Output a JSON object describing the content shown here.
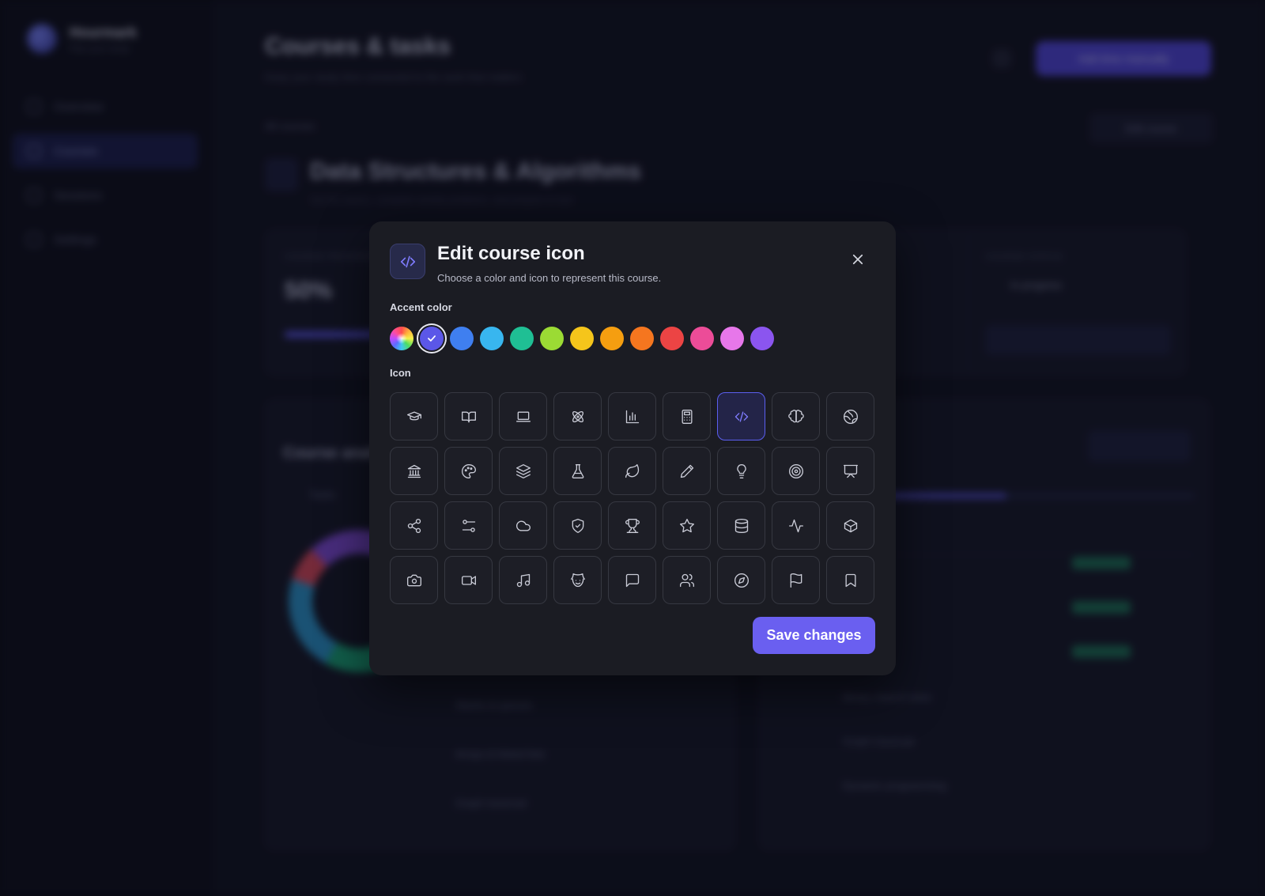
{
  "background": {
    "brand": {
      "name": "Hourmark",
      "sub": "Plan your study"
    },
    "nav": [
      {
        "label": "Overview"
      },
      {
        "label": "Courses"
      },
      {
        "label": "Sessions"
      },
      {
        "label": "Settings"
      }
    ],
    "page_title": "Courses & tasks",
    "page_sub": "Keep your study time connected to the work that matters",
    "top_button": "Add time manually",
    "back_link": "All courses",
    "edit_course": "Edit course",
    "course_title": "Data Structures & Algorithms",
    "course_sub": "Get the basics, complete weekly problems, and prepare to test",
    "progress_label": "COURSE PROGRESS",
    "progress_value": "50%",
    "status_label": "COURSE STATUS",
    "status_value": "In progress",
    "course_analytics": "Course analytics",
    "add_task": "Add task",
    "tasks_tab": "Tasks",
    "task_rows": [
      "Stacks & queues",
      "Arrays & linked lists",
      "Graph traversal",
      "Binary search trees",
      "Graph traversal",
      "Dynamic programming"
    ]
  },
  "modal": {
    "title": "Edit course icon",
    "subtitle": "Choose a color and icon to represent this course.",
    "accent_label": "Accent color",
    "icon_label": "Icon",
    "save_label": "Save changes",
    "selected_color": "#6a5ff0",
    "accent_colors": [
      "rainbow",
      "#5b57e8",
      "#3f7ff0",
      "#38b6ef",
      "#1fbf94",
      "#9bdb34",
      "#f5c51b",
      "#f59e10",
      "#f5761f",
      "#ec4444",
      "#ec4c98",
      "#e777ea",
      "#8b55ef"
    ],
    "selected_icon": "code-icon",
    "icons": [
      "graduation-cap-icon",
      "book-open-icon",
      "laptop-icon",
      "atom-icon",
      "bar-chart-icon",
      "calculator-icon",
      "code-icon",
      "brain-icon",
      "globe-icon",
      "landmark-icon",
      "palette-icon",
      "layers-icon",
      "flask-icon",
      "leaf-icon",
      "pencil-icon",
      "lightbulb-icon",
      "target-icon",
      "presentation-icon",
      "share-icon",
      "git-compare-icon",
      "cloud-icon",
      "shield-check-icon",
      "trophy-icon",
      "star-icon",
      "database-icon",
      "activity-icon",
      "box-icon",
      "camera-icon",
      "video-icon",
      "music-icon",
      "theater-masks-icon",
      "message-square-icon",
      "users-icon",
      "compass-icon",
      "flag-icon",
      "bookmark-icon"
    ]
  }
}
